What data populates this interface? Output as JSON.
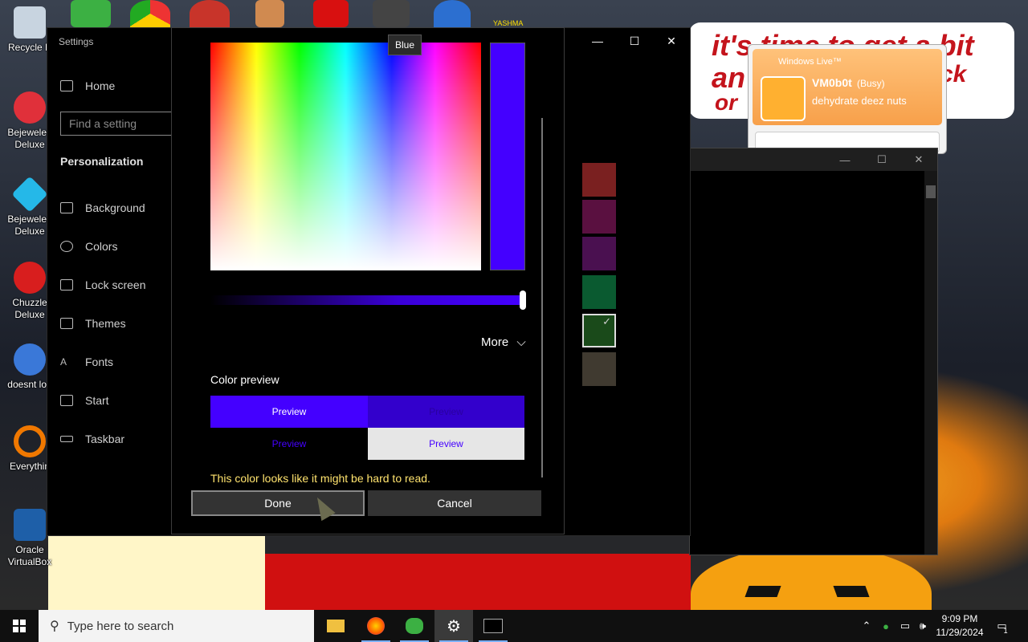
{
  "desktop": {
    "icons": [
      {
        "label": "Recycle B",
        "icon": "recycle-bin-icon",
        "color": "#c8d4e0"
      },
      {
        "label": "Bejeweled Deluxe",
        "icon": "bejeweled-icon",
        "color": "#e0303a"
      },
      {
        "label": "Bejeweled Deluxe",
        "icon": "bejeweled-gem-icon",
        "color": "#25b8e8"
      },
      {
        "label": "Chuzzle Deluxe",
        "icon": "chuzzle-icon",
        "color": "#d81e1e"
      },
      {
        "label": "doesnt loa",
        "icon": "thunderbird-icon",
        "color": "#3a78d8"
      },
      {
        "label": "Everythin",
        "icon": "everything-search-icon",
        "color": "#f07800"
      },
      {
        "label": "Oracle VirtualBox",
        "icon": "virtualbox-icon",
        "color": "#1e5fa8"
      }
    ],
    "top_icons": [
      "messenger-people-icon",
      "chrome-icon",
      "opera-icon",
      "paint-icon",
      "flash-icon",
      "game-icon",
      "thunderbird-icon"
    ],
    "top_label": "YASHMA",
    "banner_lines": [
      "it's time to get a bit",
      "an",
      "ck",
      "or"
    ]
  },
  "settings": {
    "title": "Settings",
    "home_label": "Home",
    "search_placeholder": "Find a setting",
    "section": "Personalization",
    "nav": [
      "Background",
      "Colors",
      "Lock screen",
      "Themes",
      "Fonts",
      "Start",
      "Taskbar"
    ],
    "window_controls": [
      "—",
      "☐",
      "✕"
    ],
    "accent_swatches": [
      "#7a2020",
      "#5a1040",
      "#4a1050",
      "#0a5a30",
      "#1a4a1a",
      "#403a30"
    ]
  },
  "color_dialog": {
    "tooltip": "Blue",
    "selected_color": "#4400ff",
    "more_label": "More",
    "preview_heading": "Color preview",
    "preview_label": "Preview",
    "warning": "This color looks like it might be hard to read.",
    "done_label": "Done",
    "cancel_label": "Cancel"
  },
  "console": {
    "controls": [
      "—",
      "☐",
      "✕"
    ]
  },
  "messenger": {
    "title": "Windows Live™",
    "username": "VM0b0t",
    "status": "(Busy)",
    "personal_message": "dehydrate deez nuts"
  },
  "taskbar": {
    "search_placeholder": "Type here to search",
    "apps": [
      "file-explorer-icon",
      "firefox-icon",
      "messenger-icon",
      "settings-icon",
      "terminal-icon"
    ],
    "time": "9:09 PM",
    "date": "11/29/2024",
    "notification_count": "1"
  }
}
